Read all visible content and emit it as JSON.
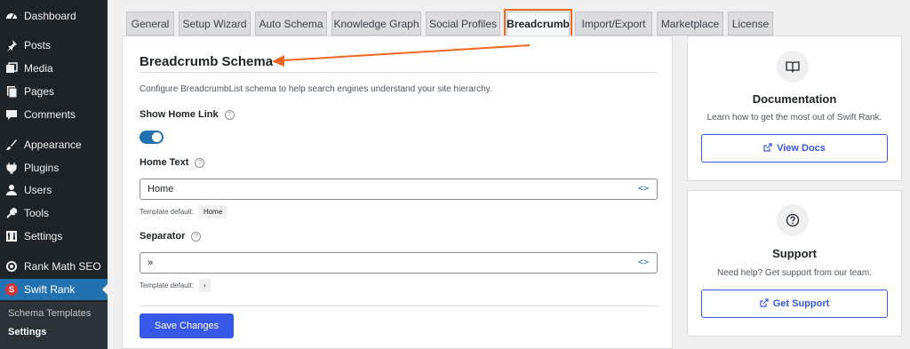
{
  "sidebar": {
    "items": [
      {
        "label": "Dashboard",
        "icon": "dashboard-icon"
      },
      {
        "label": "Posts",
        "icon": "pin-icon"
      },
      {
        "label": "Media",
        "icon": "media-icon"
      },
      {
        "label": "Pages",
        "icon": "pages-icon"
      },
      {
        "label": "Comments",
        "icon": "comment-icon"
      },
      {
        "label": "Appearance",
        "icon": "brush-icon"
      },
      {
        "label": "Plugins",
        "icon": "plug-icon"
      },
      {
        "label": "Users",
        "icon": "user-icon"
      },
      {
        "label": "Tools",
        "icon": "wrench-icon"
      },
      {
        "label": "Settings",
        "icon": "settings-icon"
      },
      {
        "label": "Rank Math SEO",
        "icon": "rank-math-icon"
      },
      {
        "label": "Swift Rank",
        "icon": "swift-rank-icon",
        "logo_letter": "S"
      }
    ],
    "submenu": [
      {
        "label": "Schema Templates"
      },
      {
        "label": "Settings"
      }
    ]
  },
  "tabs": [
    {
      "label": "General"
    },
    {
      "label": "Setup Wizard"
    },
    {
      "label": "Auto Schema"
    },
    {
      "label": "Knowledge Graph"
    },
    {
      "label": "Social Profiles"
    },
    {
      "label": "Breadcrumb"
    },
    {
      "label": "Import/Export"
    },
    {
      "label": "Marketplace"
    },
    {
      "label": "License"
    }
  ],
  "main": {
    "title": "Breadcrumb Schema",
    "description": "Configure BreadcrumbList schema to help search engines understand your site hierarchy.",
    "show_home_link": {
      "label": "Show Home Link",
      "enabled": true
    },
    "home_text": {
      "label": "Home Text",
      "value": "Home",
      "template_label": "Template default:",
      "template_value": "Home"
    },
    "separator": {
      "label": "Separator",
      "value": "»",
      "template_label": "Template default:",
      "template_value": "›"
    },
    "save_label": "Save Changes",
    "help_glyph": "?",
    "code_glyph": "<>"
  },
  "cards": {
    "docs": {
      "title": "Documentation",
      "description": "Learn how to get the most out of Swift Rank.",
      "button": "View Docs"
    },
    "support": {
      "title": "Support",
      "description": "Need help? Get support from our team.",
      "button": "Get Support"
    }
  },
  "colors": {
    "accent": "#3858e9",
    "annotation": "#f26722",
    "sidebar": "#1d2327",
    "current": "#2271b1"
  }
}
